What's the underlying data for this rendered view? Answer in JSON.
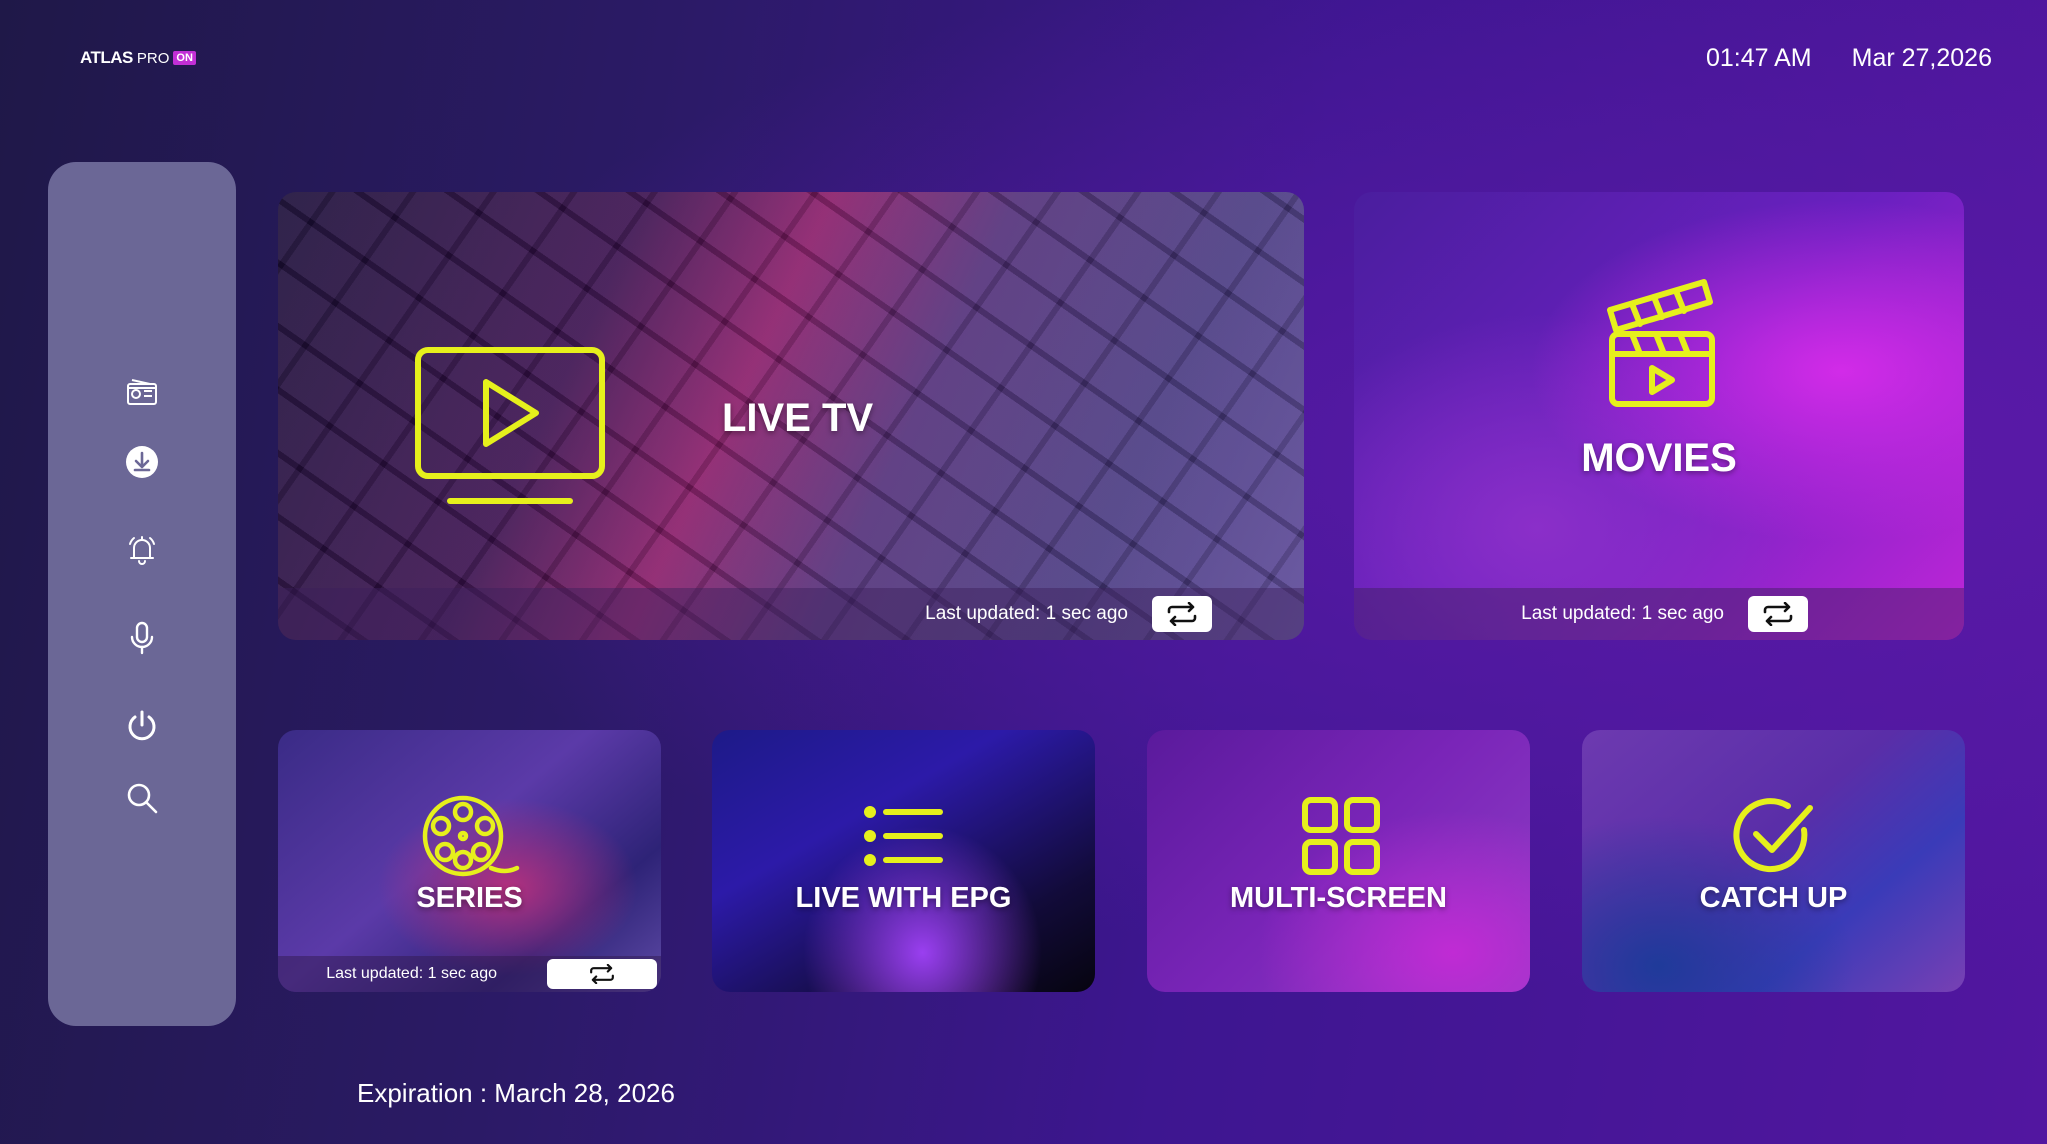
{
  "header": {
    "logo": {
      "brand": "ATLAS",
      "suffix": "PRO",
      "badge": "ON"
    },
    "time": "01:47 AM",
    "date": "Mar 27,2026"
  },
  "sidebar": {
    "items": [
      {
        "icon": "radio-icon"
      },
      {
        "icon": "download-icon"
      },
      {
        "icon": "bell-icon"
      },
      {
        "icon": "microphone-icon"
      },
      {
        "icon": "power-icon"
      },
      {
        "icon": "search-icon"
      }
    ]
  },
  "cards": {
    "live_tv": {
      "label": "LIVE TV",
      "updated": "Last updated: 1 sec ago",
      "icon": "tv-play-icon"
    },
    "movies": {
      "label": "MOVIES",
      "updated": "Last updated: 1 sec ago",
      "icon": "clapperboard-icon"
    },
    "series": {
      "label": "SERIES",
      "updated": "Last updated: 1 sec ago",
      "icon": "film-reel-icon"
    },
    "live_epg": {
      "label": "LIVE WITH EPG",
      "icon": "list-icon"
    },
    "multi_screen": {
      "label": "MULTI-SCREEN",
      "icon": "grid-icon"
    },
    "catch_up": {
      "label": "CATCH UP",
      "icon": "check-circle-icon"
    }
  },
  "footer": {
    "expiration": "Expiration : March 28, 2026"
  },
  "colors": {
    "accent": "#e6f01c",
    "sidebar": "#6b6796"
  }
}
